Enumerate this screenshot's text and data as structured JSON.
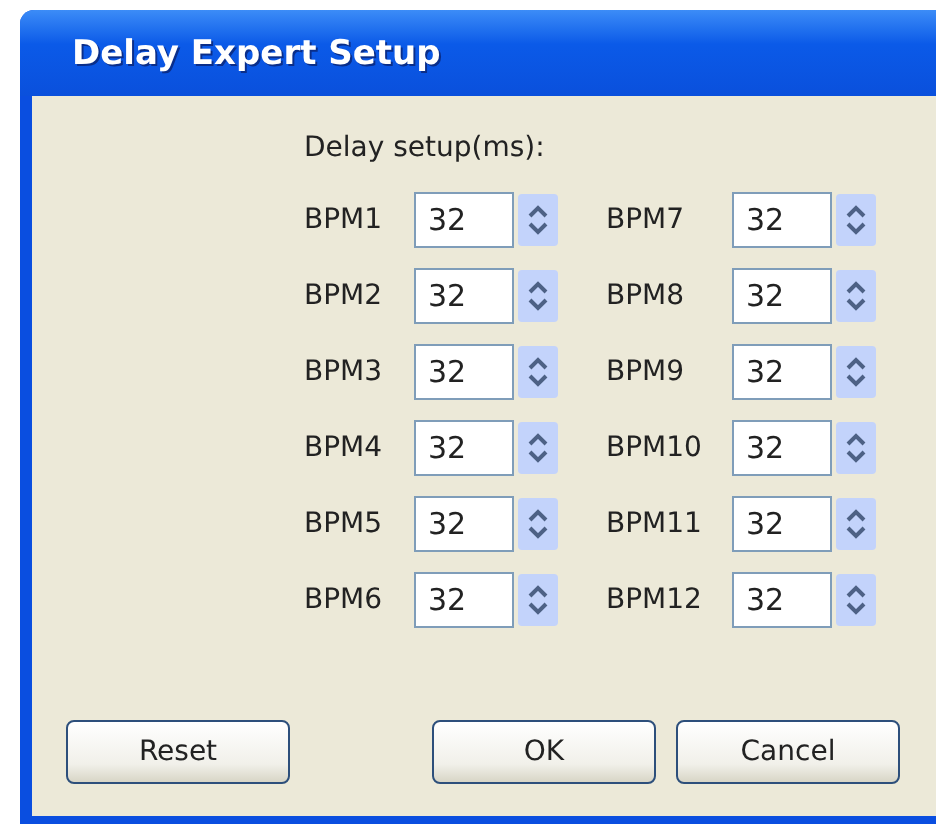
{
  "window": {
    "title": "Delay Expert Setup"
  },
  "heading": "Delay setup(ms):",
  "columns": [
    [
      {
        "label": "BPM1",
        "value": "32"
      },
      {
        "label": "BPM2",
        "value": "32"
      },
      {
        "label": "BPM3",
        "value": "32"
      },
      {
        "label": "BPM4",
        "value": "32"
      },
      {
        "label": "BPM5",
        "value": "32"
      },
      {
        "label": "BPM6",
        "value": "32"
      }
    ],
    [
      {
        "label": "BPM7",
        "value": "32"
      },
      {
        "label": "BPM8",
        "value": "32"
      },
      {
        "label": "BPM9",
        "value": "32"
      },
      {
        "label": "BPM10",
        "value": "32"
      },
      {
        "label": "BPM11",
        "value": "32"
      },
      {
        "label": "BPM12",
        "value": "32"
      }
    ]
  ],
  "buttons": {
    "left": [
      "Reset"
    ],
    "right": [
      "OK",
      "Cancel"
    ]
  }
}
